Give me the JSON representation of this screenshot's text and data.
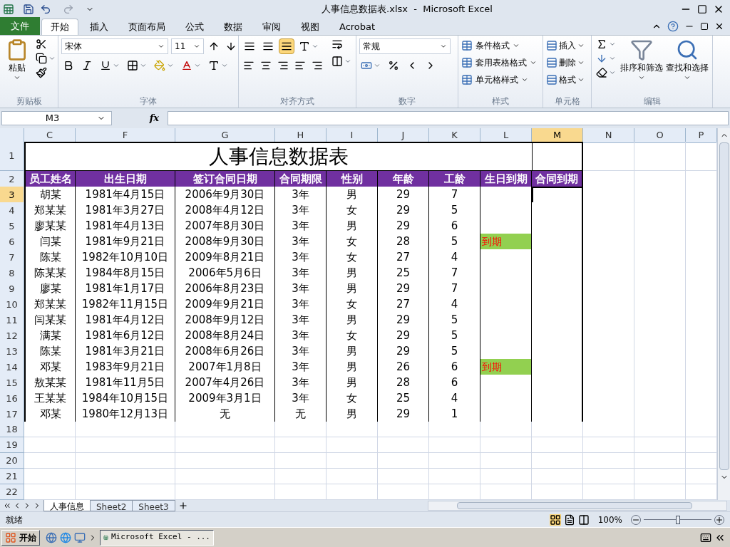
{
  "title_bar": {
    "title": "人事信息数据表.xlsx  -  Microsoft Excel"
  },
  "ribbon_tabs": [
    {
      "label": "文件",
      "kind": "file",
      "selected": false
    },
    {
      "label": "开始",
      "kind": "tab",
      "selected": true
    },
    {
      "label": "插入",
      "kind": "tab",
      "selected": false
    },
    {
      "label": "页面布局",
      "kind": "tab",
      "selected": false
    },
    {
      "label": "公式",
      "kind": "tab",
      "selected": false
    },
    {
      "label": "数据",
      "kind": "tab",
      "selected": false
    },
    {
      "label": "审阅",
      "kind": "tab",
      "selected": false
    },
    {
      "label": "视图",
      "kind": "tab",
      "selected": false
    },
    {
      "label": "Acrobat",
      "kind": "tab",
      "selected": false
    }
  ],
  "ribbon": {
    "clipboard": {
      "paste": "粘贴",
      "group": "剪贴板"
    },
    "font": {
      "name": "宋体",
      "size": "11",
      "group": "字体"
    },
    "alignment": {
      "group": "对齐方式",
      "vertical_align": [
        {
          "selected": false
        },
        {
          "selected": false
        },
        {
          "selected": true
        }
      ]
    },
    "number": {
      "format": "常规",
      "group": "数字"
    },
    "styles": {
      "items": [
        "条件格式",
        "套用表格格式",
        "单元格样式"
      ],
      "group": "样式"
    },
    "cells": {
      "items": [
        "插入",
        "删除",
        "格式"
      ],
      "group": "单元格"
    },
    "editing": {
      "sort": "排序和筛选",
      "find": "查找和选择",
      "group": "编辑"
    }
  },
  "formula_bar": {
    "name_box": "M3",
    "fx": "fx"
  },
  "sheet": {
    "columns": [
      {
        "label": "C",
        "selected": false
      },
      {
        "label": "F",
        "selected": false
      },
      {
        "label": "G",
        "selected": false
      },
      {
        "label": "H",
        "selected": false
      },
      {
        "label": "I",
        "selected": false
      },
      {
        "label": "J",
        "selected": false
      },
      {
        "label": "K",
        "selected": false
      },
      {
        "label": "L",
        "selected": false
      },
      {
        "label": "M",
        "selected": true
      },
      {
        "label": "N",
        "selected": false
      },
      {
        "label": "O",
        "selected": false
      },
      {
        "label": "P",
        "selected": false
      }
    ],
    "rows": [
      {
        "label": "1",
        "selected": false
      },
      {
        "label": "2",
        "selected": false
      },
      {
        "label": "3",
        "selected": true
      },
      {
        "label": "4",
        "selected": false
      },
      {
        "label": "5",
        "selected": false
      },
      {
        "label": "6",
        "selected": false
      },
      {
        "label": "7",
        "selected": false
      },
      {
        "label": "8",
        "selected": false
      },
      {
        "label": "9",
        "selected": false
      },
      {
        "label": "10",
        "selected": false
      },
      {
        "label": "11",
        "selected": false
      },
      {
        "label": "12",
        "selected": false
      },
      {
        "label": "13",
        "selected": false
      },
      {
        "label": "14",
        "selected": false
      },
      {
        "label": "15",
        "selected": false
      },
      {
        "label": "16",
        "selected": false
      },
      {
        "label": "17",
        "selected": false
      },
      {
        "label": "18",
        "selected": false
      },
      {
        "label": "19",
        "selected": false
      },
      {
        "label": "20",
        "selected": false
      },
      {
        "label": "21",
        "selected": false
      },
      {
        "label": "22",
        "selected": false
      }
    ],
    "title": "人事信息数据表",
    "headers": [
      "员工姓名",
      "出生日期",
      "签订合同日期",
      "合同期限",
      "性别",
      "年龄",
      "工龄",
      "生日到期",
      "合同到期"
    ],
    "records": [
      {
        "cells": [
          "胡某",
          "1981年4月15日",
          "2006年9月30日",
          "3年",
          "男",
          "29",
          "7"
        ]
      },
      {
        "cells": [
          "郑某某",
          "1981年3月27日",
          "2008年4月12日",
          "3年",
          "女",
          "29",
          "5"
        ]
      },
      {
        "cells": [
          "廖某某",
          "1981年4月13日",
          "2007年8月30日",
          "3年",
          "男",
          "29",
          "6"
        ]
      },
      {
        "cells": [
          "闫某",
          "1981年9月21日",
          "2008年9月30日",
          "3年",
          "女",
          "28",
          "5"
        ],
        "birthday_due": "到期"
      },
      {
        "cells": [
          "陈某",
          "1982年10月10日",
          "2009年8月21日",
          "3年",
          "女",
          "27",
          "4"
        ]
      },
      {
        "cells": [
          "陈某某",
          "1984年8月15日",
          "2006年5月6日",
          "3年",
          "男",
          "25",
          "7"
        ]
      },
      {
        "cells": [
          "廖某",
          "1981年1月17日",
          "2006年8月23日",
          "3年",
          "男",
          "29",
          "7"
        ]
      },
      {
        "cells": [
          "郑某某",
          "1982年11月15日",
          "2009年9月21日",
          "3年",
          "女",
          "27",
          "4"
        ]
      },
      {
        "cells": [
          "闫某某",
          "1981年4月12日",
          "2008年9月12日",
          "3年",
          "男",
          "29",
          "5"
        ]
      },
      {
        "cells": [
          "满某",
          "1981年6月12日",
          "2008年8月24日",
          "3年",
          "女",
          "29",
          "5"
        ]
      },
      {
        "cells": [
          "陈某",
          "1981年3月21日",
          "2008年6月26日",
          "3年",
          "男",
          "29",
          "5"
        ]
      },
      {
        "cells": [
          "邓某",
          "1983年9月21日",
          "2007年1月8日",
          "3年",
          "男",
          "26",
          "6"
        ],
        "birthday_due": "到期"
      },
      {
        "cells": [
          "敖某某",
          "1981年11月5日",
          "2007年4月26日",
          "3年",
          "男",
          "28",
          "6"
        ]
      },
      {
        "cells": [
          "王某某",
          "1984年10月15日",
          "2009年3月1日",
          "3年",
          "女",
          "25",
          "4"
        ]
      },
      {
        "cells": [
          "邓某",
          "1980年12月13日",
          "无",
          "无",
          "男",
          "29",
          "1"
        ]
      }
    ]
  },
  "sheet_tabs": [
    {
      "label": "人事信息",
      "selected": true
    },
    {
      "label": "Sheet2",
      "selected": false
    },
    {
      "label": "Sheet3",
      "selected": false
    }
  ],
  "status_bar": {
    "status": "就绪",
    "zoom": "100%",
    "zoom_slider": {
      "level": 0.5
    }
  },
  "taskbar": {
    "start": "开始",
    "window": "Microsoft Excel - ..."
  }
}
